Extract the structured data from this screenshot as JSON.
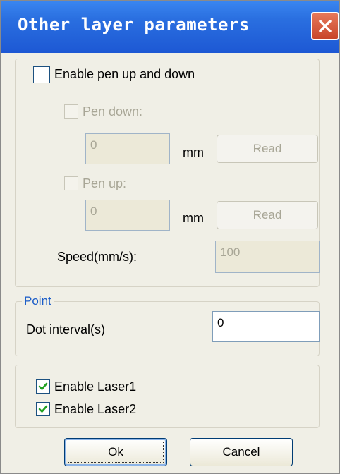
{
  "window": {
    "title": "Other layer parameters"
  },
  "pen": {
    "enable_label": "Enable pen up and down",
    "enable_checked": false,
    "pen_down_label": "Pen down:",
    "pen_down_value": "0",
    "pen_up_label": "Pen up:",
    "pen_up_value": "0",
    "unit": "mm",
    "read_label": "Read",
    "speed_label": "Speed(mm/s):",
    "speed_value": "100"
  },
  "point": {
    "legend": "Point",
    "dot_interval_label": "Dot interval(s)",
    "dot_interval_value": "0"
  },
  "lasers": {
    "laser1_label": "Enable Laser1",
    "laser1_checked": true,
    "laser2_label": "Enable Laser2",
    "laser2_checked": true
  },
  "buttons": {
    "ok_label": "Ok",
    "cancel_label": "Cancel"
  },
  "colors": {
    "title_bar": "#2a6fe0",
    "close_button": "#d85c3c",
    "legend_text": "#1a5cc8",
    "check_mark": "#21a121"
  },
  "icons": {
    "close": "close-icon",
    "check": "check-icon"
  }
}
